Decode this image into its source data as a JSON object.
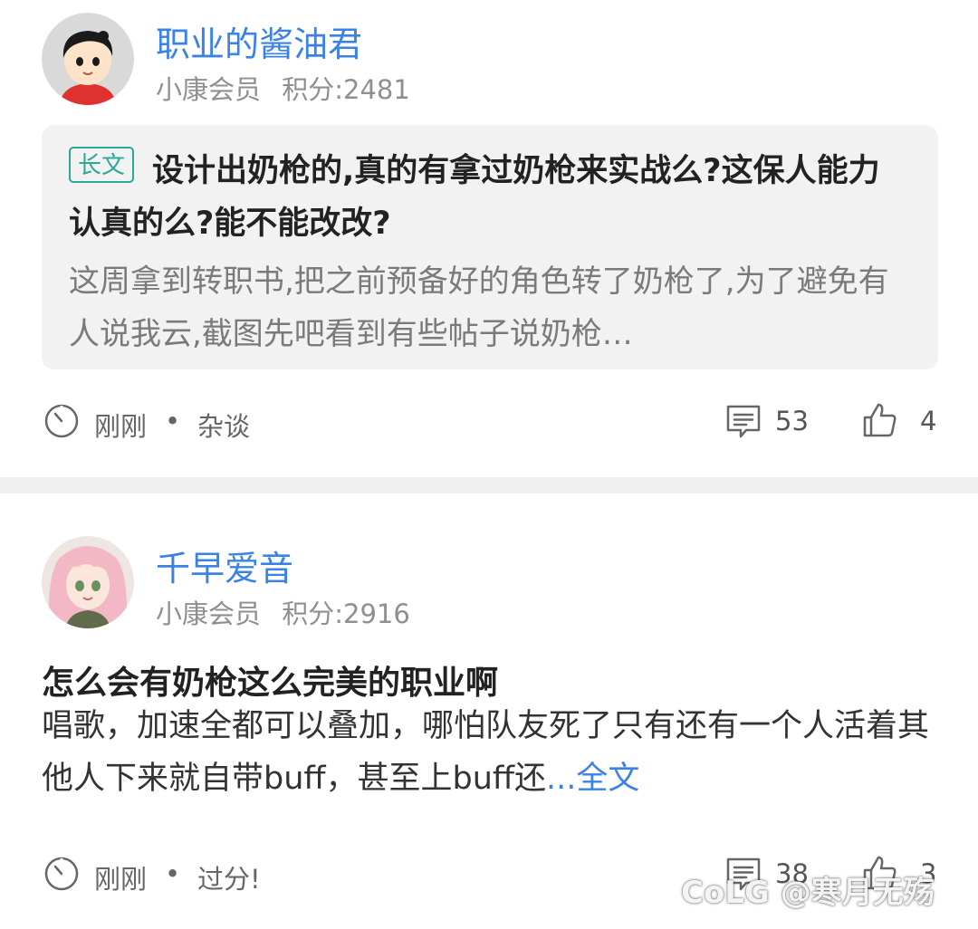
{
  "posts": [
    {
      "username": "职业的酱油君",
      "member_level": "小康会员",
      "points": "积分:2481",
      "quote": {
        "tag": "长文",
        "title": "设计出奶枪的,真的有拿过奶枪来实战么?这保人能力认真的么?能不能改改?",
        "excerpt": "这周拿到转职书,把之前预备好的角色转了奶枪了,为了避免有人说我云,截图先吧看到有些帖子说奶枪…"
      },
      "time": "刚刚",
      "separator": "•",
      "category": "杂谈",
      "comment_count": "53",
      "like_count": "4"
    },
    {
      "username": "千早爱音",
      "member_level": "小康会员",
      "points": "积分:2916",
      "title": "怎么会有奶枪这么完美的职业啊",
      "body": "唱歌，加速全都可以叠加，哪怕队友死了只有还有一个人活着其他人下来就自带buff，甚至上buff还",
      "more": "...全文",
      "time": "刚刚",
      "separator": "•",
      "category": "过分!",
      "comment_count": "38",
      "like_count": "3"
    }
  ],
  "watermark": "CoLG @寒月无殇",
  "colors": {
    "username": "#3b82e6",
    "tag": "#2aa89a",
    "quote_background": "#f2f2f2",
    "divider": "#f0f0f0",
    "meta_text": "#8f8f8f"
  },
  "icons": {
    "time": "clock-icon",
    "comments": "comment-icon",
    "likes": "thumbs-up-icon"
  }
}
